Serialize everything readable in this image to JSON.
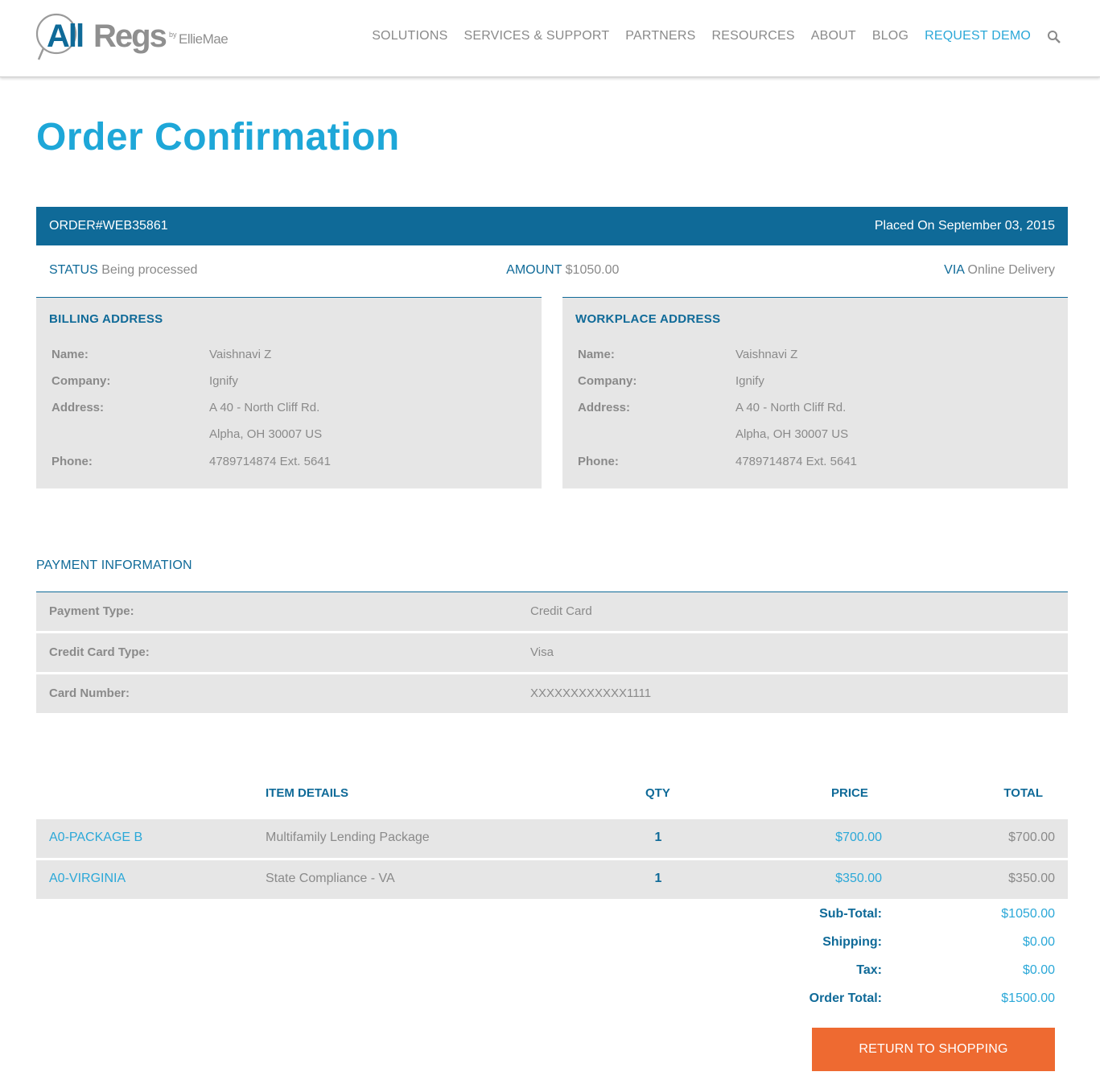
{
  "header": {
    "logo_text": "AllRegs",
    "logo_sub": "by EllieMae",
    "nav": [
      "SOLUTIONS",
      "SERVICES & SUPPORT",
      "PARTNERS",
      "RESOURCES",
      "ABOUT",
      "BLOG",
      "REQUEST DEMO"
    ],
    "search_icon": "search-icon"
  },
  "page_title": "Order Confirmation",
  "order": {
    "number": "ORDER#WEB35861",
    "placed": "Placed On September 03, 2015",
    "status_label": "STATUS",
    "status_value": "Being processed",
    "amount_label": "AMOUNT",
    "amount_value": "$1050.00",
    "via_label": "VIA",
    "via_value": "Online Delivery"
  },
  "billing": {
    "title": "BILLING ADDRESS",
    "name_label": "Name:",
    "name": "Vaishnavi Z",
    "company_label": "Company:",
    "company": "Ignify",
    "address_label": "Address:",
    "address1": "A 40 - North Cliff Rd.",
    "address2": "Alpha, OH 30007 US",
    "phone_label": "Phone:",
    "phone": "4789714874 Ext. 5641"
  },
  "workplace": {
    "title": "WORKPLACE ADDRESS",
    "name_label": "Name:",
    "name": "Vaishnavi Z",
    "company_label": "Company:",
    "company": "Ignify",
    "address_label": "Address:",
    "address1": "A 40 - North Cliff Rd.",
    "address2": "Alpha, OH 30007 US",
    "phone_label": "Phone:",
    "phone": "4789714874 Ext. 5641"
  },
  "payment": {
    "title": "PAYMENT INFORMATION",
    "rows": [
      {
        "label": "Payment Type:",
        "value": "Credit Card"
      },
      {
        "label": "Credit Card Type:",
        "value": "Visa"
      },
      {
        "label": "Card Number:",
        "value": "XXXXXXXXXXXX1111"
      }
    ]
  },
  "items": {
    "headers": {
      "details": "ITEM DETAILS",
      "qty": "QTY",
      "price": "PRICE",
      "total": "TOTAL"
    },
    "rows": [
      {
        "code": "A0-PACKAGE B",
        "desc": "Multifamily Lending Package",
        "qty": "1",
        "price": "$700.00",
        "total": "$700.00"
      },
      {
        "code": "A0-VIRGINIA",
        "desc": "State Compliance - VA",
        "qty": "1",
        "price": "$350.00",
        "total": "$350.00"
      }
    ]
  },
  "totals": {
    "subtotal_label": "Sub-Total:",
    "subtotal": "$1050.00",
    "shipping_label": "Shipping:",
    "shipping": "$0.00",
    "tax_label": "Tax:",
    "tax": "$0.00",
    "order_total_label": "Order Total:",
    "order_total": "$1500.00"
  },
  "return_button": "RETURN TO SHOPPING",
  "colors": {
    "brand_blue": "#0f6a98",
    "accent_cyan": "#1ea7d8",
    "button_orange": "#ee6a31",
    "panel_gray": "#e6e6e6"
  }
}
